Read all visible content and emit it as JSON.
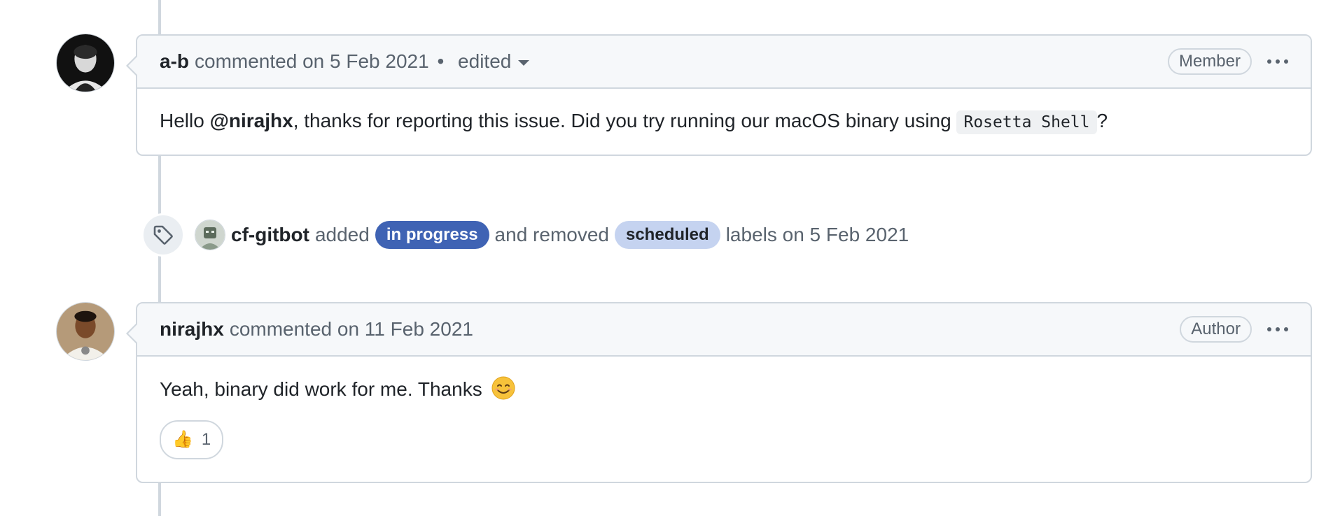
{
  "comments": [
    {
      "author": "a-b",
      "action": "commented on 5 Feb 2021",
      "separator": "•",
      "edited_label": "edited",
      "role": "Member",
      "body": {
        "prefix": "Hello ",
        "mention": "@nirajhx",
        "middle": ", thanks for reporting this issue. Did you try running our macOS binary using ",
        "code": "Rosetta Shell",
        "suffix": "?"
      }
    },
    {
      "author": "nirajhx",
      "action": "commented on 11 Feb 2021",
      "role": "Author",
      "body": {
        "text": "Yeah, binary did work for me. Thanks"
      },
      "reaction": {
        "emoji": "👍",
        "count": "1"
      }
    }
  ],
  "event": {
    "icon": "tag-icon",
    "author": "cf-gitbot",
    "added_text": "added",
    "added_label": "in progress",
    "middle_text": "and removed",
    "removed_label": "scheduled",
    "suffix": "labels on 5 Feb 2021"
  },
  "colors": {
    "label_in_progress": "#3f63b4",
    "label_scheduled": "#c5d3f0",
    "border": "#d0d7de",
    "header_bg": "#f6f8fa"
  }
}
